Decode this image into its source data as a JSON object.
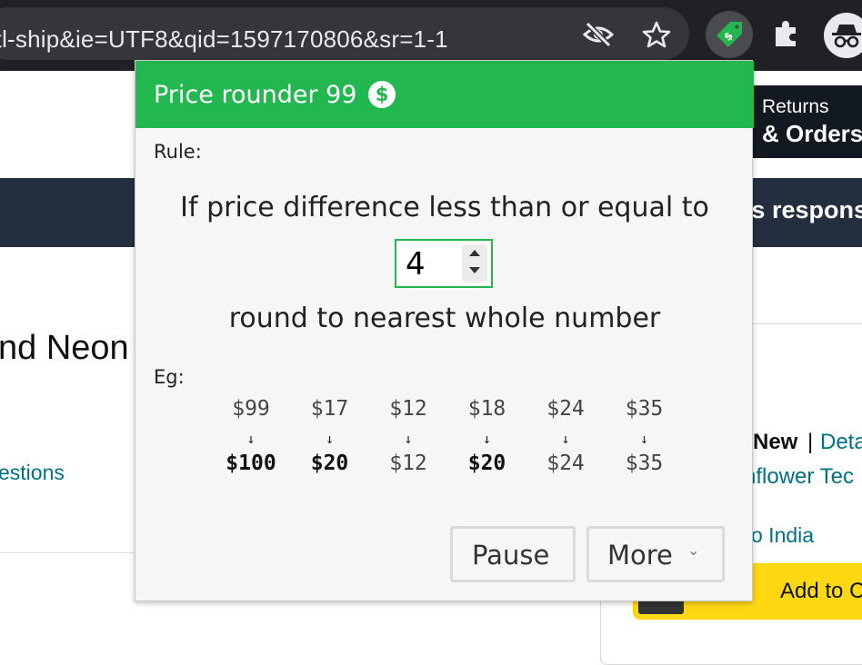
{
  "browser": {
    "url": "ntl-ship&ie=UTF8&qid=1597170806&sr=1-1",
    "icons": [
      "eye-slash-icon",
      "star-icon",
      "price-rounder-extension-icon",
      "puzzle-extensions-icon",
      "incognito-profile-icon"
    ]
  },
  "background_page": {
    "returns_line1": "Returns",
    "returns_line2": "& Orders",
    "subnav_text": "'s respons",
    "title_fragment": "nd Neon",
    "questions_link": "estions",
    "condition_new": "New",
    "separator": "|",
    "details_link": "Deta",
    "seller_link": "nflower Tec",
    "ship_link": "o India",
    "add_to_cart": "Add to C"
  },
  "popup": {
    "title": "Price rounder 99",
    "badge_symbol": "$",
    "rule_label": "Rule:",
    "rule_line1": "If price difference less than or equal to",
    "threshold_value": "4",
    "rule_line2": "round to nearest whole number",
    "eg_label": "Eg:",
    "arrow_glyph": "↓",
    "examples": [
      {
        "from": "$99",
        "to": "$100",
        "rounded": true
      },
      {
        "from": "$17",
        "to": "$20",
        "rounded": true
      },
      {
        "from": "$12",
        "to": "$12",
        "rounded": false
      },
      {
        "from": "$18",
        "to": "$20",
        "rounded": true
      },
      {
        "from": "$24",
        "to": "$24",
        "rounded": false
      },
      {
        "from": "$35",
        "to": "$35",
        "rounded": false
      }
    ],
    "pause_button": "Pause",
    "more_button": "More",
    "more_chevron": "⌄",
    "accent_color": "#22b84f"
  }
}
